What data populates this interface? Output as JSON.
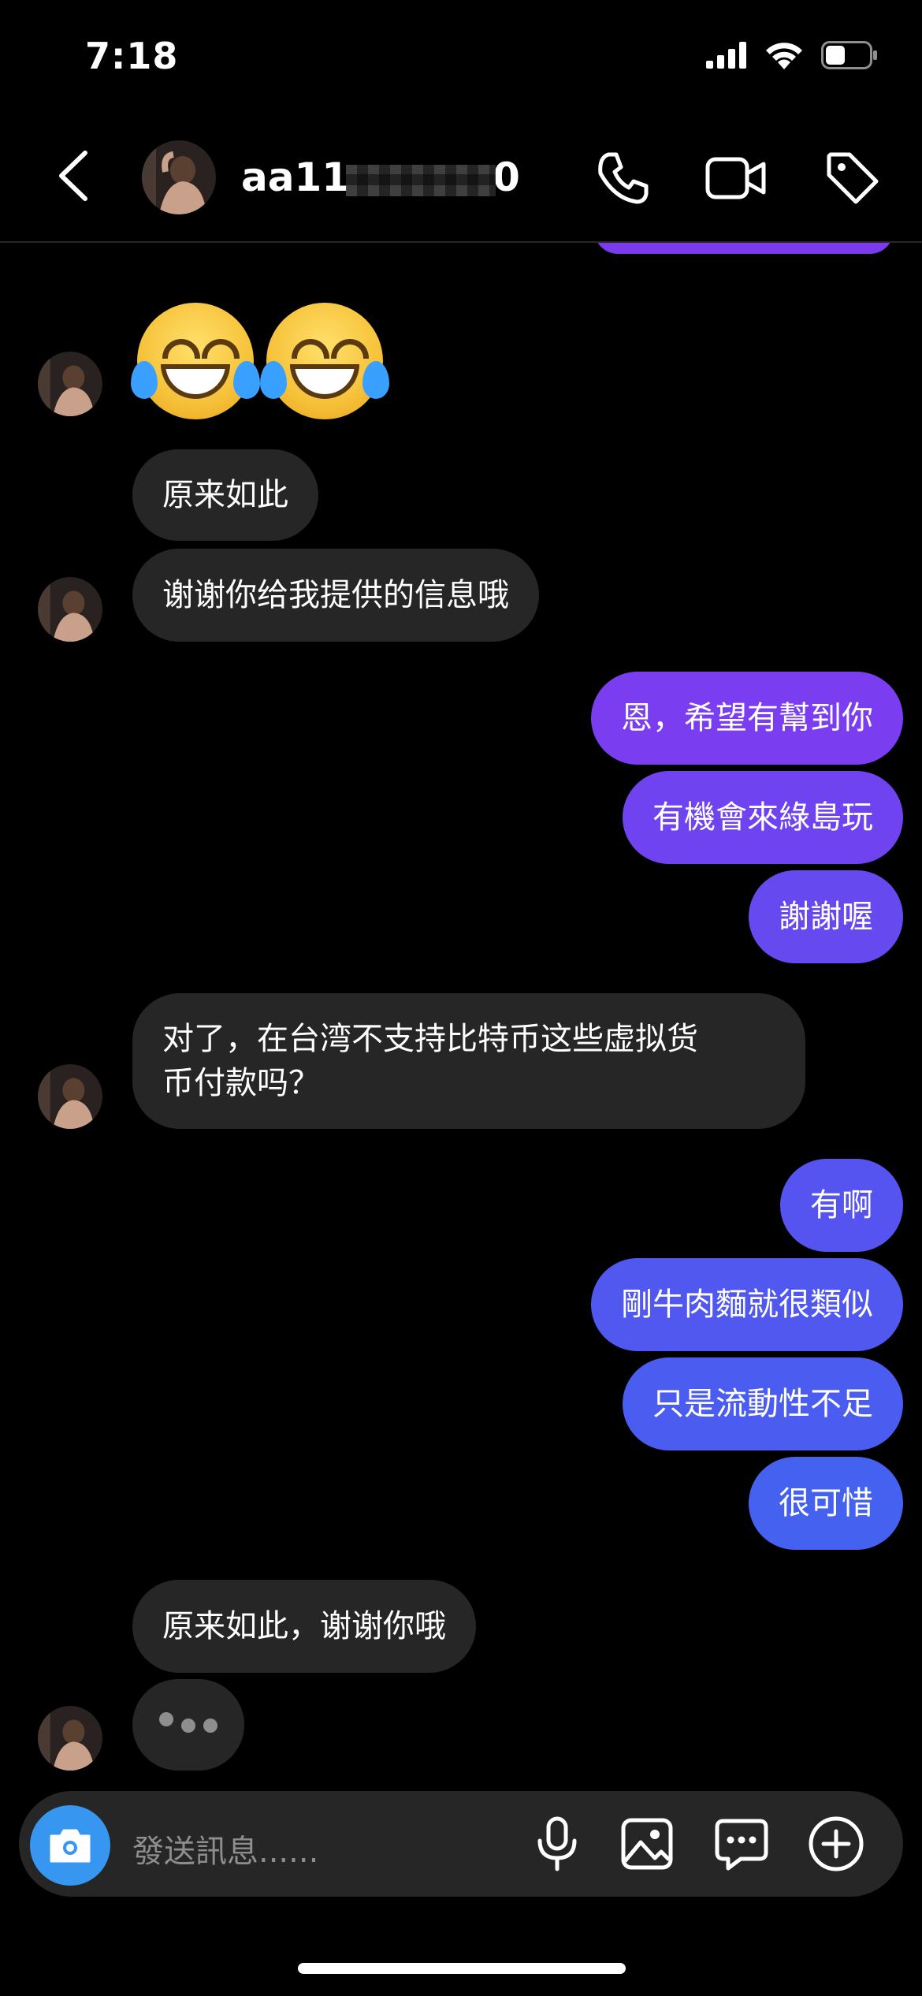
{
  "status_bar": {
    "time": "7:18"
  },
  "header": {
    "username_prefix": "aa11",
    "username_suffix": "0"
  },
  "messages": [
    {
      "side": "in",
      "text": "原来如此"
    },
    {
      "side": "in",
      "text": "谢谢你给我提供的信息哦"
    },
    {
      "side": "out",
      "text": "恩，希望有幫到你"
    },
    {
      "side": "out",
      "text": "有機會來綠島玩"
    },
    {
      "side": "out",
      "text": "謝謝喔"
    },
    {
      "side": "in",
      "text_line1": "对了，在台湾不支持比特币这些虚拟货",
      "text_line2": "币付款吗？"
    },
    {
      "side": "out",
      "text": "有啊"
    },
    {
      "side": "out",
      "text": "剛牛肉麵就很類似"
    },
    {
      "side": "out",
      "text": "只是流動性不足"
    },
    {
      "side": "out",
      "text": "很可惜"
    },
    {
      "side": "in",
      "text": "原来如此，谢谢你哦"
    }
  ],
  "composer": {
    "placeholder": "發送訊息......"
  },
  "icons": [
    "back-chevron-icon",
    "phone-icon",
    "video-camera-icon",
    "tag-icon",
    "camera-icon",
    "microphone-icon",
    "image-icon",
    "sticker-chat-icon",
    "plus-icon",
    "face-with-tears-of-joy-emoji"
  ],
  "colors": {
    "incoming_bubble": "#262626",
    "outgoing_top": "#8b3ff0",
    "outgoing_bottom": "#4a5ff0",
    "camera_button": "#3797f0"
  }
}
